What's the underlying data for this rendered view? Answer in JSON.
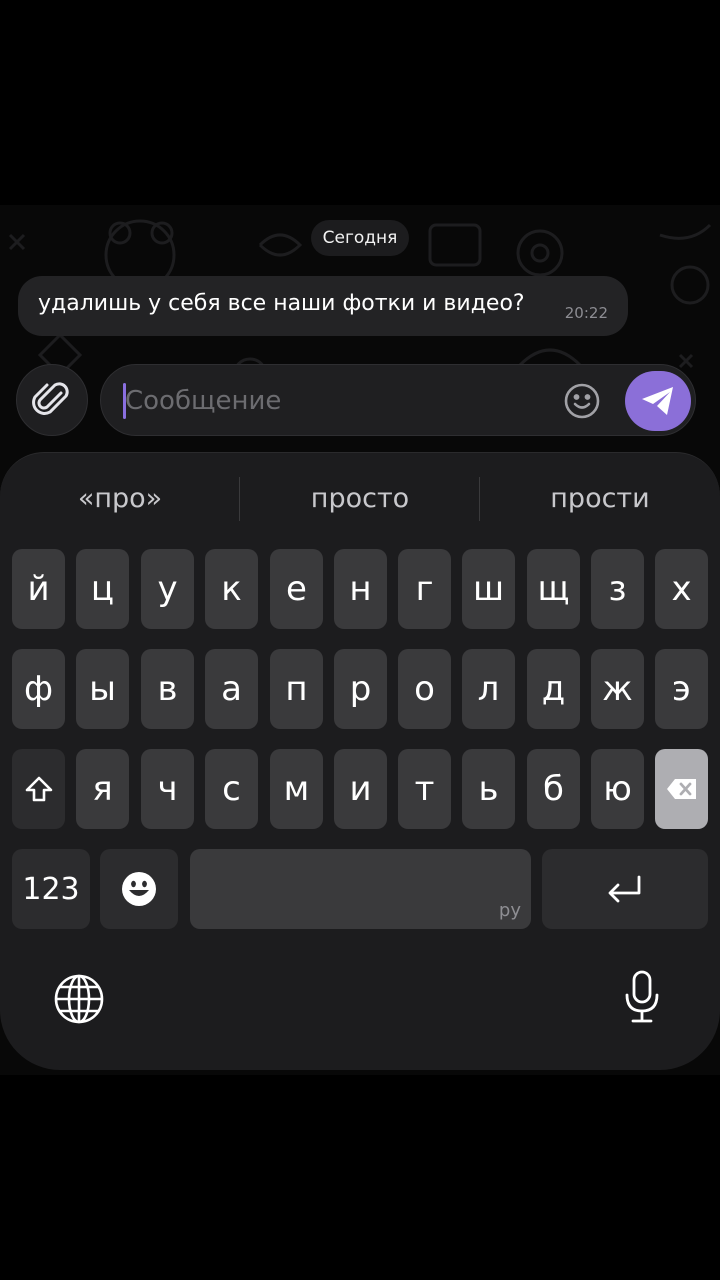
{
  "chat": {
    "date_separator": "Сегодня",
    "message": {
      "text": "удалишь у себя все наши фотки и видео?",
      "time": "20:22"
    }
  },
  "composer": {
    "placeholder": "Сообщение",
    "icons": {
      "attach": "paperclip-icon",
      "emoji": "smiley-icon",
      "send": "send-paper-plane-icon"
    },
    "accent_color": "#8b6fd8"
  },
  "keyboard": {
    "suggestions": [
      "«про»",
      "просто",
      "прости"
    ],
    "row1": [
      "й",
      "ц",
      "у",
      "к",
      "е",
      "н",
      "г",
      "ш",
      "щ",
      "з",
      "х"
    ],
    "row2": [
      "ф",
      "ы",
      "в",
      "а",
      "п",
      "р",
      "о",
      "л",
      "д",
      "ж",
      "э"
    ],
    "row3": [
      "я",
      "ч",
      "с",
      "м",
      "и",
      "т",
      "ь",
      "б",
      "ю"
    ],
    "numbers_label": "123",
    "space_language": "ру",
    "icons": {
      "shift": "shift-arrow-icon",
      "backspace": "backspace-icon",
      "emoji": "emoji-face-icon",
      "return": "return-icon",
      "globe": "globe-icon",
      "mic": "microphone-icon"
    }
  }
}
